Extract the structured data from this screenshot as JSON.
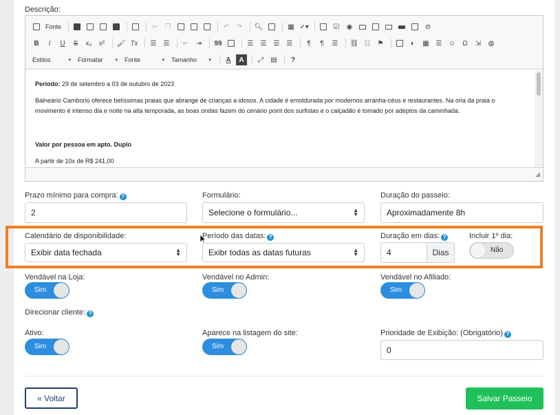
{
  "editor": {
    "label": "Descrição:",
    "toolbar": {
      "source_label": "Fonte",
      "combos": [
        "Estilos",
        "Formatar",
        "Fonte",
        "Tamanho"
      ],
      "bold": "B",
      "italic": "I",
      "underline": "U",
      "strike": "S",
      "subscript": "x₂",
      "superscript": "x²",
      "remove_format": "Tx",
      "quote": "99",
      "omega": "Ω",
      "help": "?",
      "text_color": "A",
      "bg_color": "A"
    },
    "content": {
      "period_label": "Período:",
      "period_value": " 29 de setembro a 03 de outubro de 2023",
      "paragraph": "Balneário Camboriú oferece belíssimas praias que abrange de crianças a idosos. A cidade é emoldurada por modernos arranha-céus e restaurantes. Na orla da praia o movimento é intenso dia e noite na alta temporada, as boas ondas fazem do cenário point dos surfistas e o calçadão é tomado por adeptos da caminhada.",
      "price_heading": "Valor por pessoa em apto. Duplo",
      "price_line": "A partir de 10x de R$ 241,00"
    }
  },
  "form": {
    "prazo": {
      "label": "Prazo mínimo para compra:",
      "value": "2"
    },
    "formulario": {
      "label": "Formulário:",
      "value": "Selecione o formulário..."
    },
    "duracao_passeio": {
      "label": "Duração do passeio:",
      "value": "Aproximadamente 8h"
    },
    "calendario": {
      "label": "Calendário de disponibilidade:",
      "value": "Exibir data fechada"
    },
    "periodo_datas": {
      "label": "Período das datas:",
      "value": "Exibr todas as datas futuras"
    },
    "duracao_dias": {
      "label": "Duração em dias:",
      "value": "4",
      "addon": "Dias"
    },
    "incluir_dia": {
      "label": "Incluir 1º dia:",
      "state": "Não"
    },
    "vendavel_loja": {
      "label": "Vendável na Loja:",
      "state": "Sim"
    },
    "vendavel_admin": {
      "label": "Vendável no Admin:",
      "state": "Sim"
    },
    "vendavel_afiliado": {
      "label": "Vendável no Afiliado:",
      "state": "Sim"
    },
    "direcionar": {
      "label": "Direcionar cliente:"
    },
    "ativo": {
      "label": "Ativo:",
      "state": "Sim"
    },
    "listagem": {
      "label": "Aparece na listagem do site:",
      "state": "Sim"
    },
    "prioridade": {
      "label": "Prioridade de Exibição: (Obrigatório)",
      "value": "0"
    }
  },
  "buttons": {
    "back": "« Voltar",
    "save": "Salvar Passeio"
  },
  "colors": {
    "accent": "#2d8ee0",
    "highlight": "#f07f1f",
    "save": "#1fc05a",
    "back_border": "#1f3f73"
  }
}
